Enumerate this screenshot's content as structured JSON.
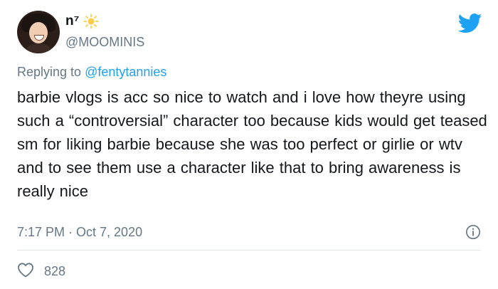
{
  "tweet": {
    "display_name": "n⁷",
    "handle": "@MOOMINIS",
    "replying_prefix": "Replying to",
    "replying_to": "@fentytannies",
    "text": "barbie vlogs is acc so nice to watch and i love how theyre using such a “controversial” character too because kids would get teased sm for liking barbie because she was too perfect or girlie or wtv and to see them use a character like that to bring awareness is really nice",
    "timestamp": "7:17 PM · Oct 7, 2020",
    "like_count": "828"
  },
  "icons": {
    "name_emoji": "sun-icon",
    "brand": "twitter-bird-icon",
    "info": "info-icon",
    "like": "heart-icon"
  },
  "colors": {
    "brand": "#1da1f2",
    "secondary_text": "#657786",
    "sun": "#ffcc4d",
    "divider": "#e1e8ed"
  }
}
